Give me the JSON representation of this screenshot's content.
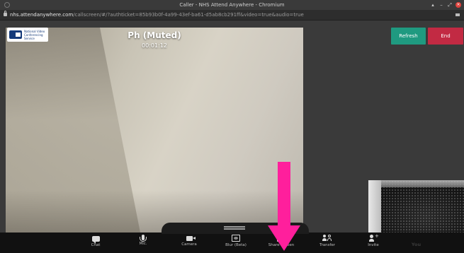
{
  "browser": {
    "window_title": "Caller - NHS Attend Anywhere - Chromium",
    "url_host": "nhs.attendanywhere.com",
    "url_path": "/callscreen/#/?authticket=85b93b0f-4a99-43ef-ba61-d5ab8cb291ff&video=true&audio=true"
  },
  "logo": {
    "text": "National Video Conferencing Service"
  },
  "call": {
    "caller_name": "Ph (Muted)",
    "timer": "00:01:12",
    "self_view_label": "You"
  },
  "actions": {
    "refresh": "Refresh",
    "end": "End"
  },
  "toolbar": {
    "items": [
      {
        "label": "Chat",
        "icon": "chat-icon"
      },
      {
        "label": "Mic.",
        "icon": "microphone-icon"
      },
      {
        "label": "Camera",
        "icon": "camera-icon"
      },
      {
        "label": "Blur (Beta)",
        "icon": "blur-icon"
      },
      {
        "label": "Share Screen",
        "icon": "share-screen-icon"
      },
      {
        "label": "Transfer",
        "icon": "transfer-icon"
      },
      {
        "label": "Invite",
        "icon": "invite-icon"
      }
    ]
  },
  "colors": {
    "refresh": "#1f9a80",
    "end": "#c22a43",
    "annotation_arrow": "#ff1f9c",
    "toolbar_bg": "#111111"
  }
}
